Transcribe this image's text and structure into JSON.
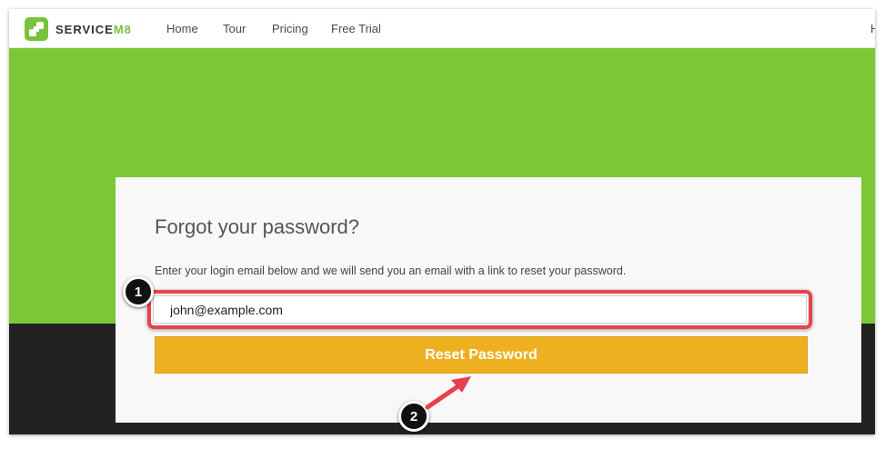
{
  "brand": {
    "name_main": "SERVICE",
    "name_accent": "M8"
  },
  "nav": {
    "items": [
      {
        "label": "Home"
      },
      {
        "label": "Tour"
      },
      {
        "label": "Pricing"
      },
      {
        "label": "Free Trial"
      }
    ],
    "cut_item": "H"
  },
  "colors": {
    "hero": "#7cc734",
    "button": "#eeb020",
    "highlight": "#e5434b",
    "footer": "#222222"
  },
  "form": {
    "title": "Forgot your password?",
    "description": "Enter your login email below and we will send you an email with a link to reset your password.",
    "email_value": "john@example.com",
    "button_label": "Reset Password"
  },
  "annotations": {
    "step1": "1",
    "step2": "2"
  }
}
